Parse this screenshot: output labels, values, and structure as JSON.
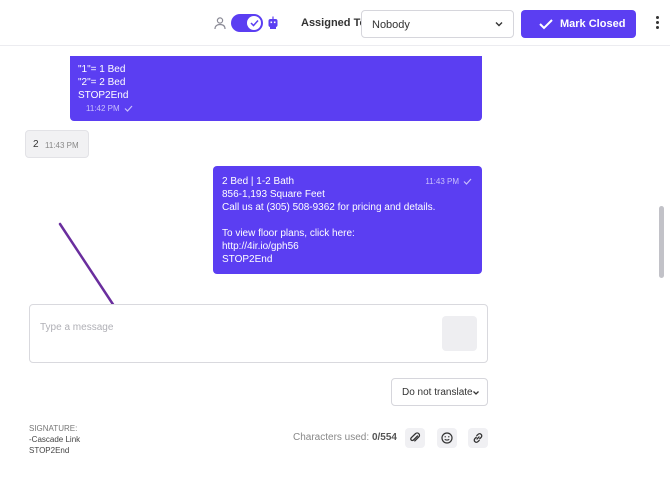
{
  "header": {
    "assigned_label": "Assigned To:",
    "assignee": "Nobody",
    "mark_closed_label": "Mark Closed",
    "accent": "#5b3ef2"
  },
  "messages": [
    {
      "direction": "outgoing",
      "text": "\"1\"= 1 Bed\n\"2\"= 2 Bed\nSTOP2End",
      "time": "11:42 PM"
    },
    {
      "direction": "incoming",
      "text": "2",
      "time": "11:43 PM"
    },
    {
      "direction": "outgoing",
      "text": "2 Bed | 1-2 Bath\n856-1,193 Square Feet\nCall us at (305) 508-9362 for pricing and details.\n\nTo view floor plans, click here:\nhttp://4ir.io/gph56\nSTOP2End",
      "time": "11:43 PM"
    }
  ],
  "composer": {
    "placeholder": "Type a message",
    "translate_label": "Do not translate",
    "chars_label": "Characters used:",
    "chars_value": "0/554"
  },
  "signature": {
    "heading": "SIGNATURE:",
    "line1": "-Cascade Link",
    "line2": "STOP2End"
  },
  "icons": {
    "person": "person-icon",
    "bot": "bot-icon",
    "attach": "paperclip-icon",
    "emoji": "smiley-icon",
    "link": "link-icon"
  }
}
